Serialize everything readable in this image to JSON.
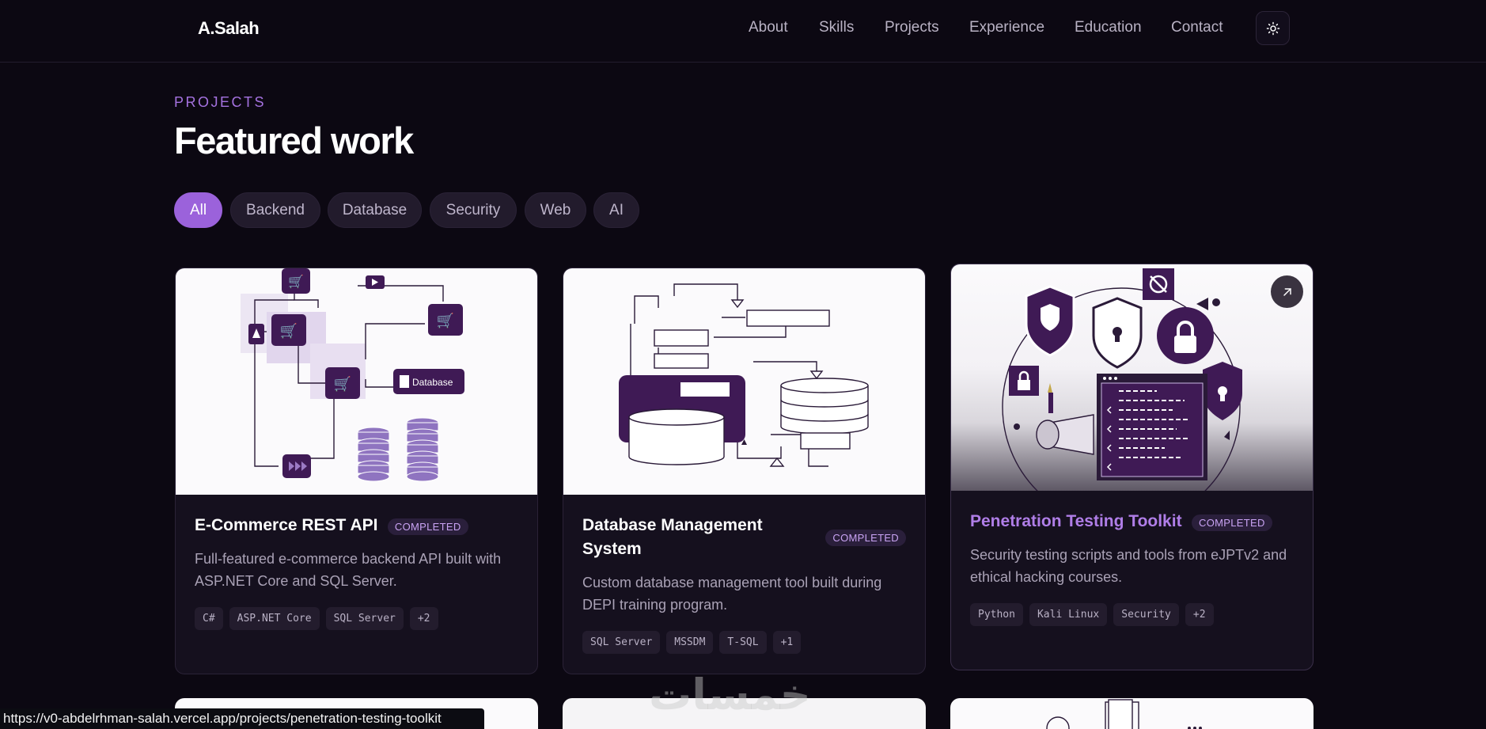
{
  "brand": "A.Salah",
  "nav": {
    "items": [
      "About",
      "Skills",
      "Projects",
      "Experience",
      "Education",
      "Contact"
    ],
    "theme_icon": "sun-icon"
  },
  "section": {
    "eyebrow": "PROJECTS",
    "title": "Featured work"
  },
  "filters": {
    "items": [
      "All",
      "Backend",
      "Database",
      "Security",
      "Web",
      "AI"
    ],
    "active": "All"
  },
  "projects": [
    {
      "title": "E-Commerce REST API",
      "status": "COMPLETED",
      "description": "Full-featured e-commerce backend API built with ASP.NET Core and SQL Server.",
      "tags": [
        "C#",
        "ASP.NET Core",
        "SQL Server",
        "+2"
      ],
      "thumb_label": "Database"
    },
    {
      "title": "Database Management System",
      "status": "COMPLETED",
      "description": "Custom database management tool built during DEPI training program.",
      "tags": [
        "SQL Server",
        "MSSDM",
        "T-SQL",
        "+1"
      ]
    },
    {
      "title": "Penetration Testing Toolkit",
      "status": "COMPLETED",
      "description": "Security testing scripts and tools from eJPTv2 and ethical hacking courses.",
      "tags": [
        "Python",
        "Kali Linux",
        "Security",
        "+2"
      ],
      "open_icon": "arrow-up-right-icon"
    }
  ],
  "status_bar": {
    "url": "https://v0-abdelrhman-salah.vercel.app/projects/penetration-testing-toolkit"
  },
  "watermark": "خمسات",
  "colors": {
    "background": "#0c0812",
    "accent": "#9b62db",
    "card": "#15101e",
    "thumb_purple": "#3f1a55"
  }
}
